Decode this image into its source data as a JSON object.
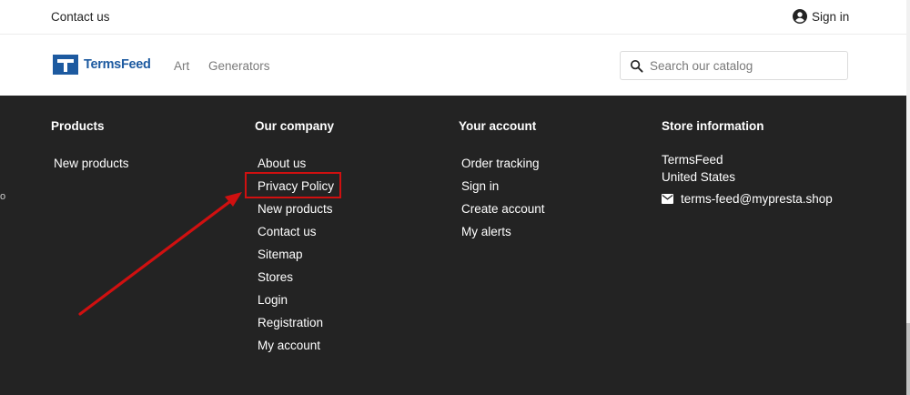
{
  "topbar": {
    "contact_label": "Contact us",
    "signin_label": "Sign in"
  },
  "header": {
    "brand": "TermsFeed",
    "nav": [
      "Art",
      "Generators"
    ],
    "search_placeholder": "Search our catalog"
  },
  "footer": {
    "products": {
      "title": "Products",
      "items": [
        "New products"
      ]
    },
    "company": {
      "title": "Our company",
      "items": [
        "About us",
        "Privacy Policy",
        "New products",
        "Contact us",
        "Sitemap",
        "Stores",
        "Login",
        "Registration",
        "My account"
      ]
    },
    "account": {
      "title": "Your account",
      "items": [
        "Order tracking",
        "Sign in",
        "Create account",
        "My alerts"
      ]
    },
    "store": {
      "title": "Store information",
      "name": "TermsFeed",
      "country": "United States",
      "email": "terms-feed@mypresta.shop"
    }
  },
  "annotation": {
    "color": "#d01010",
    "target": "Privacy Policy"
  },
  "colors": {
    "footer_bg": "#232323",
    "brand_blue": "#1d5aa0"
  }
}
